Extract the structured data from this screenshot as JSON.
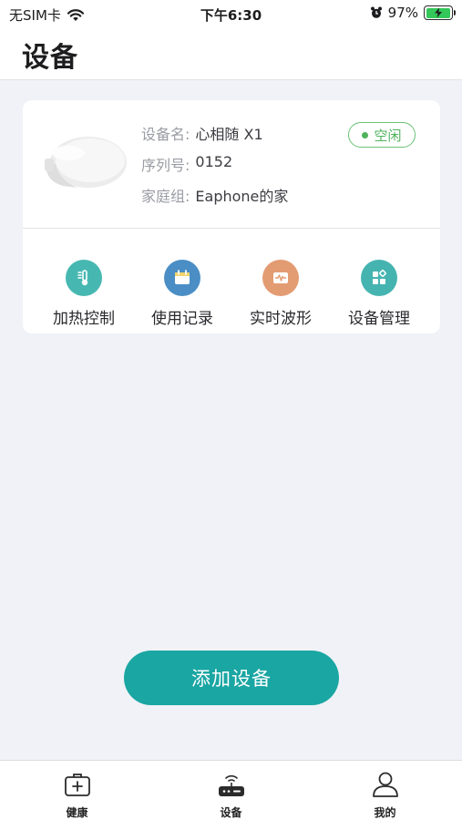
{
  "status_bar": {
    "carrier": "无SIM卡",
    "time": "下午6:30",
    "battery": "97%"
  },
  "header": {
    "title": "设备"
  },
  "device": {
    "name_label": "设备名:",
    "name_value": "心相随 X1",
    "serial_label": "序列号:",
    "serial_value": "0152",
    "group_label": "家庭组:",
    "group_value": "Eaphone的家",
    "status": "空闲",
    "actions": [
      {
        "label": "加热控制",
        "icon": "thermometer-icon",
        "color": "#47b8b1"
      },
      {
        "label": "使用记录",
        "icon": "calendar-icon",
        "color": "#4a8ec5"
      },
      {
        "label": "实时波形",
        "icon": "waveform-icon",
        "color": "#e39b72"
      },
      {
        "label": "设备管理",
        "icon": "grid-icon",
        "color": "#45b4b0"
      }
    ]
  },
  "add_button": {
    "label": "添加设备"
  },
  "tabs": [
    {
      "label": "健康",
      "icon": "health-kit-icon"
    },
    {
      "label": "设备",
      "icon": "router-icon"
    },
    {
      "label": "我的",
      "icon": "user-icon"
    }
  ],
  "colors": {
    "accent": "#1aa6a3",
    "status_green": "#4fb35c"
  }
}
